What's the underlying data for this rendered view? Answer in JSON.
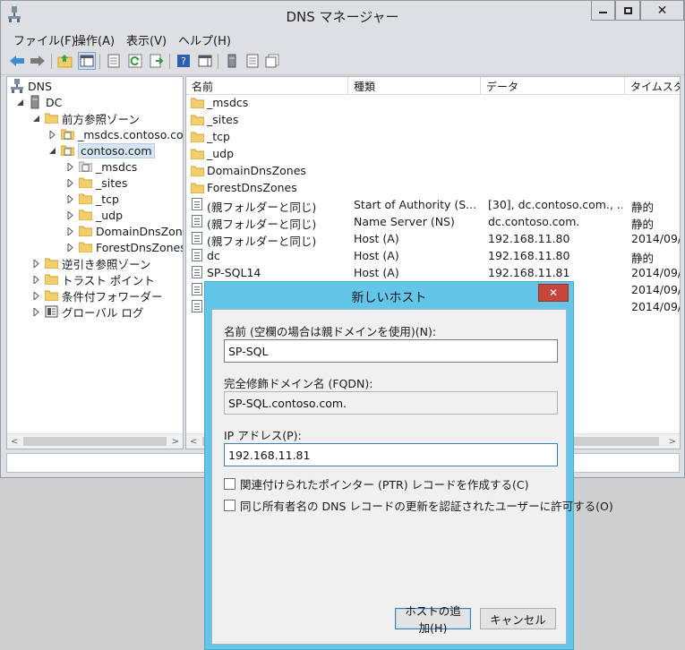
{
  "window": {
    "title": "DNS マネージャー",
    "menu": [
      "ファイル(F)",
      "操作(A)",
      "表示(V)",
      "ヘルプ(H)"
    ]
  },
  "tree": {
    "root": "DNS",
    "server": "DC",
    "forward_zones": "前方参照ゾーン",
    "msdcs_zone": "_msdcs.contoso.co",
    "contoso_zone": "contoso.com",
    "children": [
      "_msdcs",
      "_sites",
      "_tcp",
      "_udp",
      "DomainDnsZone",
      "ForestDnsZones"
    ],
    "reverse_zones": "逆引き参照ゾーン",
    "trust_points": "トラスト ポイント",
    "conditional_forwarders": "条件付フォワーダー",
    "global_logs": "グローバル ログ"
  },
  "list": {
    "columns": [
      "名前",
      "種類",
      "データ",
      "タイムスタン"
    ],
    "folders": [
      "_msdcs",
      "_sites",
      "_tcp",
      "_udp",
      "DomainDnsZones",
      "ForestDnsZones"
    ],
    "records": [
      {
        "name": "(親フォルダーと同じ)",
        "type": "Start of Authority (S...",
        "data": "[30], dc.contoso.com., ...",
        "time": "静的"
      },
      {
        "name": "(親フォルダーと同じ)",
        "type": "Name Server (NS)",
        "data": "dc.contoso.com.",
        "time": "静的"
      },
      {
        "name": "(親フォルダーと同じ)",
        "type": "Host (A)",
        "data": "192.168.11.80",
        "time": "2014/09/"
      },
      {
        "name": "dc",
        "type": "Host (A)",
        "data": "192.168.11.80",
        "time": "静的"
      },
      {
        "name": "SP-SQL14",
        "type": "Host (A)",
        "data": "192.168.11.81",
        "time": "2014/09/"
      },
      {
        "name": "",
        "type": "",
        "data": "",
        "time": "2014/09/"
      },
      {
        "name": "",
        "type": "",
        "data": "",
        "time": "2014/09/"
      }
    ]
  },
  "dialog": {
    "title": "新しいホスト",
    "name_label": "名前 (空欄の場合は親ドメインを使用)(N):",
    "name_value": "SP-SQL",
    "fqdn_label": "完全修飾ドメイン名 (FQDN):",
    "fqdn_value": "SP-SQL.contoso.com.",
    "ip_label": "IP アドレス(P):",
    "ip_value": "192.168.11.81",
    "ptr_checkbox": "関連付けられたポインター (PTR) レコードを作成する(C)",
    "auth_checkbox": "同じ所有者名の DNS レコードの更新を認証されたユーザーに許可する(O)",
    "add_button": "ホストの追加(H)",
    "cancel_button": "キャンセル"
  },
  "colors": {
    "dialog_frame": "#63c6e8",
    "close_button": "#c7463c",
    "folder": "#f2cf6b",
    "selection": "#d7e4f2"
  }
}
